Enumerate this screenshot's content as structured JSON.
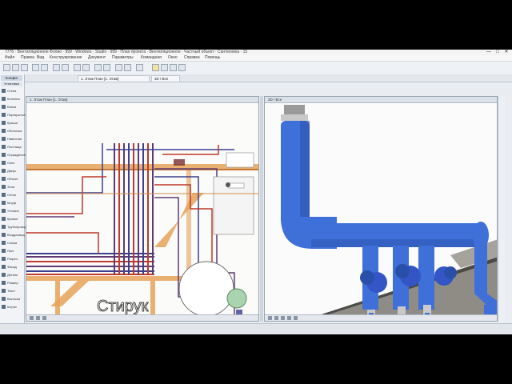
{
  "app": {
    "title": "7776 · Вентиляционное Фолио · 999 · Windows · Studio · 999 · План проекта · Вентиляционное · Частный объект · Сантехника · 15",
    "window_controls": [
      "—",
      "□",
      "✕"
    ]
  },
  "menu": [
    "Файл",
    "Правка",
    "Вид",
    "Конструирование",
    "Документ",
    "Параметры",
    "Командная",
    "Окно",
    "Справка",
    "Помощь"
  ],
  "palette": {
    "header": "Конфиг",
    "subheader": "Установки",
    "items": [
      "Стена",
      "Колонна",
      "Балка",
      "Перекрытие",
      "Крыша",
      "Оболочка",
      "Навесная",
      "Лестница",
      "Ограждение",
      "Окно",
      "Дверь",
      "Объект",
      "Зона",
      "Сетка",
      "Морф",
      "Угловое",
      "Кривое",
      "Трубопровод",
      "Воздуховод",
      "Схема",
      "Лист",
      "Разрез",
      "Фасад",
      "Деталь",
      "Размер",
      "Текст",
      "Выноска",
      "Штрих"
    ]
  },
  "tabs": {
    "plan": "1. Этаж План [1. Этаж]",
    "view3d": "3D / Все"
  },
  "plan_view": {
    "room_label": "Стирук",
    "colors": {
      "background": "#fbfbf9",
      "beam": "#e6a25a",
      "pipe_red": "#c0392b",
      "pipe_blue": "#3b3f8f",
      "pipe_purple": "#5d3a74",
      "equipment": "#a9d4ad"
    }
  },
  "view_3d": {
    "colors": {
      "pipe": "#3f6fd9",
      "pipe_shadow": "#2a4fa9",
      "floor": "#8e8c85",
      "floor_edge": "#4b4a45",
      "fitting": "#c9c9c9"
    }
  },
  "status": {
    "text": ""
  }
}
